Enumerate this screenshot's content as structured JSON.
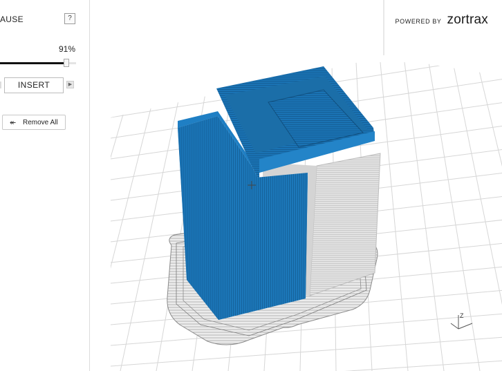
{
  "sidebar": {
    "pause_label": "AUSE",
    "help_label": "?",
    "progress_label": "91%",
    "progress_value": 0.91,
    "insert_label": "INSERT",
    "remove_all_label": "Remove All",
    "remove_icon": "back-arrow-icon"
  },
  "viewport": {
    "powered_by": "POWERED BY",
    "brand": "zortrax",
    "axis_z_label": "Z",
    "model_color": "#1f77b4",
    "support_color": "#c8c8c8",
    "grid_color": "#d8d8d8"
  }
}
